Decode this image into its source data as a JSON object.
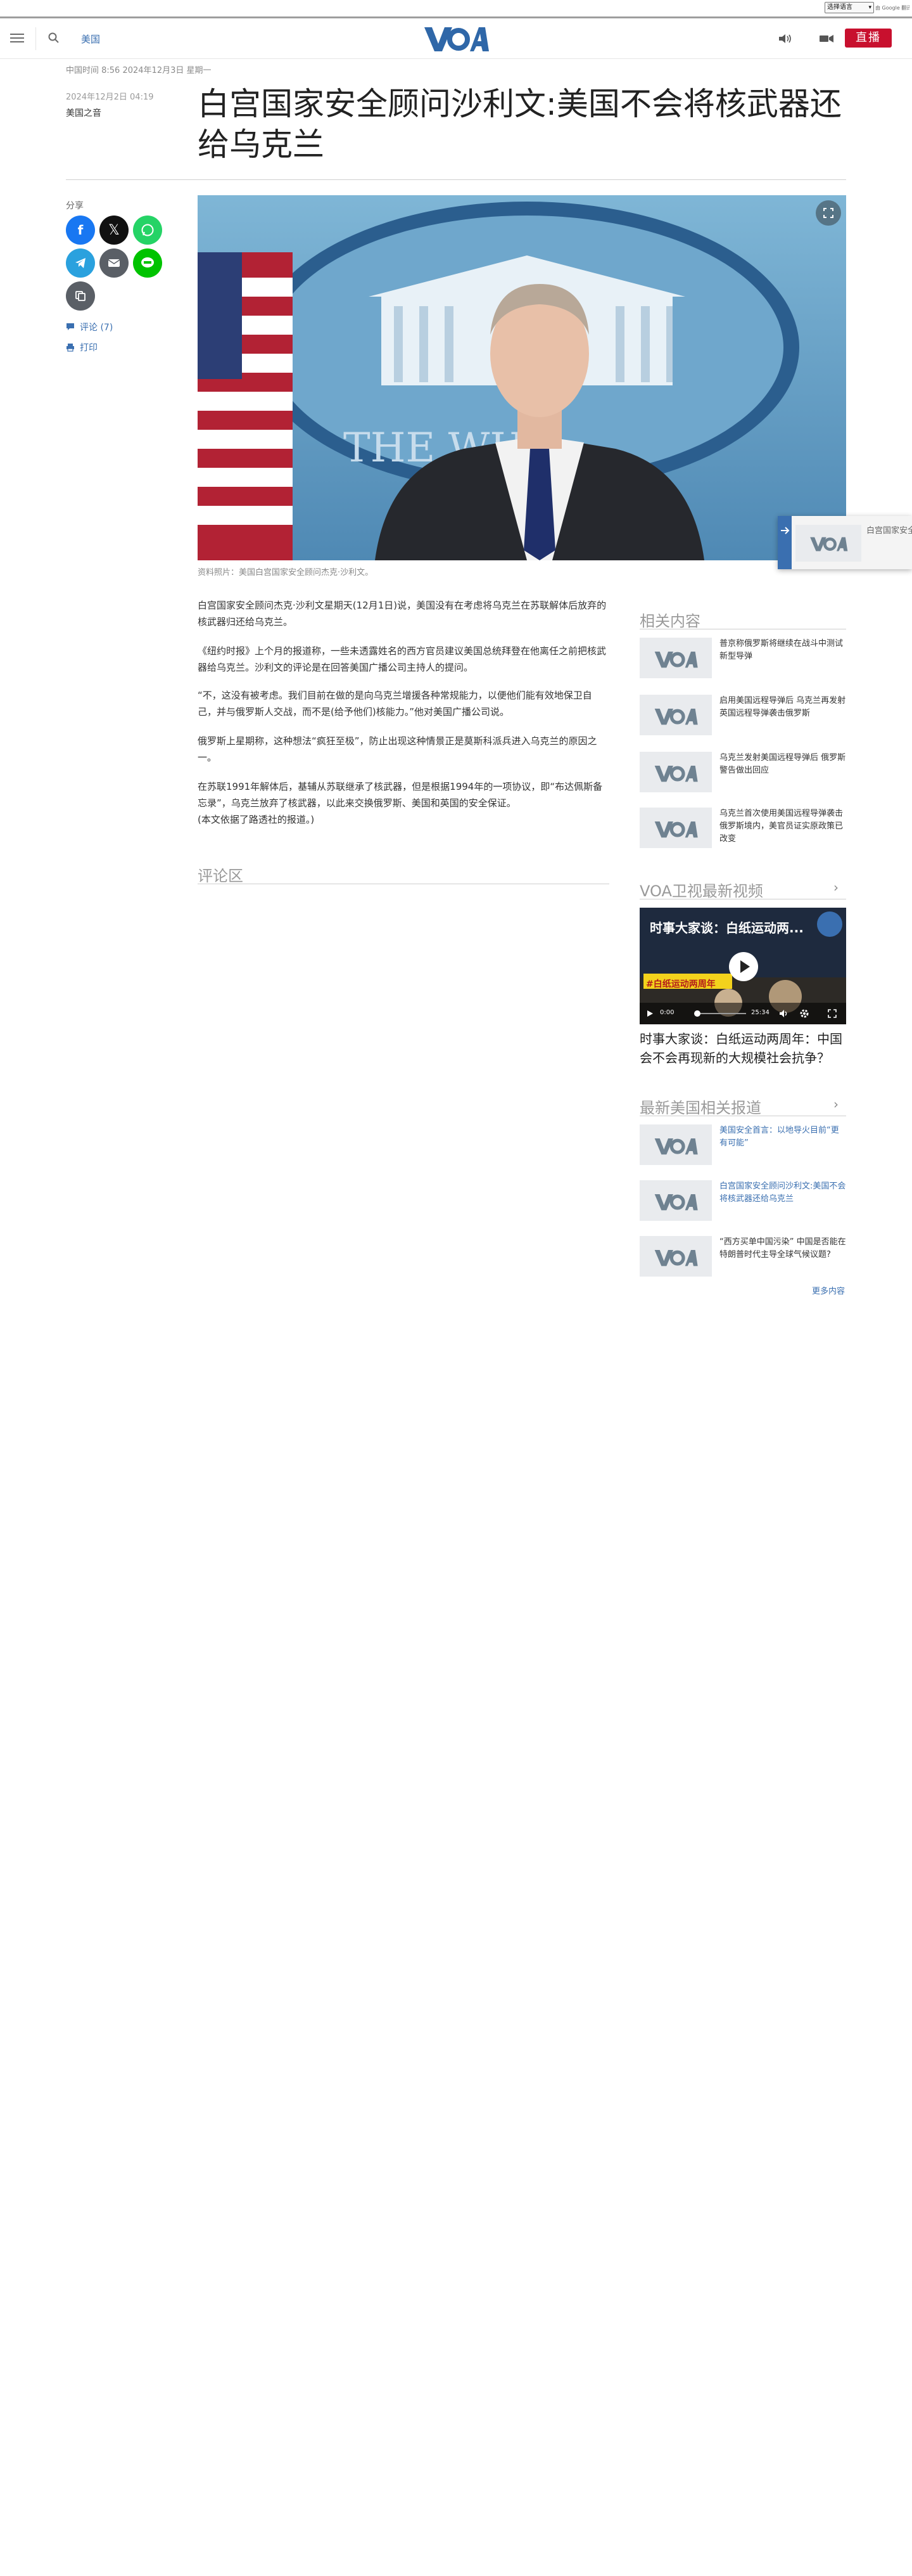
{
  "translate": {
    "select_label": "选择语言",
    "powered_by": "由 Google 翻译提供支持"
  },
  "header": {
    "section": "美国",
    "live_label": "直播"
  },
  "article": {
    "dateline": "中国时间 8:56 2024年12月3日 星期一",
    "pubdate": "2024年12月2日 04:19",
    "author": "美国之音",
    "title": "白宫国家安全顾问沙利文:美国不会将核武器还给乌克兰",
    "hero_caption": "资料照片：美国白宫国家安全顾问杰克·沙利文。",
    "hero_seal_text": "THE WH",
    "paragraphs": [
      "白宫国家安全顾问杰克·沙利文星期天(12月1日)说，美国没有在考虑将乌克兰在苏联解体后放弃的核武器归还给乌克兰。",
      "《纽约时报》上个月的报道称，一些未透露姓名的西方官员建议美国总统拜登在他离任之前把核武器给乌克兰。沙利文的评论是在回答美国广播公司主持人的提问。",
      "“不，这没有被考虑。我们目前在做的是向乌克兰增援各种常规能力，以便他们能有效地保卫自己，并与俄罗斯人交战，而不是(给予他们)核能力。”他对美国广播公司说。",
      "俄罗斯上星期称，这种想法“疯狂至极”，防止出现这种情景正是莫斯科派兵进入乌克兰的原因之一。",
      "在苏联1991年解体后，基辅从苏联继承了核武器，但是根据1994年的一项协议，即“布达佩斯备忘录”，乌克兰放弃了核武器，以此来交换俄罗斯、美国和英国的安全保证。\n(本文依据了路透社的报道。)"
    ],
    "comments_heading": "评论区"
  },
  "share": {
    "label": "分享",
    "comments_link": "评论 (7)",
    "print_link": "打印"
  },
  "floating_card": {
    "text": "白宫国家安全顾问沙利文:美国不会将核武"
  },
  "rail": {
    "related": {
      "title": "相关内容",
      "items": [
        "普京称俄罗斯将继续在战斗中测试新型导弹",
        "启用美国远程导弹后 乌克兰再发射英国远程导弹袭击俄罗斯",
        "乌克兰发射美国远程导弹后 俄罗斯警告做出回应",
        "乌克兰首次使用美国远程导弹袭击俄罗斯境内，美官员证实原政策已改变"
      ]
    },
    "tv": {
      "title": "VOA卫视最新视频",
      "video_overlay_title": "时事大家谈：白纸运动两...",
      "video_banner": "#白纸运动两周年",
      "time_current": "0:00",
      "time_total": "25:34",
      "video_title": "时事大家谈：白纸运动两周年：中国会不会再现新的大规模社会抗争？"
    },
    "latest": {
      "title": "最新美国相关报道",
      "items": [
        "美国安全首言：以地导火目前“更有可能”",
        "白宫国家安全顾问沙利文:美国不会将核武器还给乌克兰",
        "“西方买单中国污染” 中国是否能在特朗普时代主导全球气候议题?"
      ],
      "more": "更多内容"
    }
  },
  "colors": {
    "brand_blue": "#3a6fb0",
    "live_red": "#c8102e",
    "facebook": "#1877f2",
    "x": "#111111",
    "whatsapp": "#25d366",
    "telegram": "#2aa1de",
    "email": "#5a5f66",
    "line": "#00c300",
    "copy": "#5a5f66"
  },
  "icons": [
    "menu-icon",
    "search-icon",
    "voa-logo",
    "audio-icon",
    "video-icon",
    "facebook-icon",
    "x-icon",
    "whatsapp-icon",
    "telegram-icon",
    "email-icon",
    "line-icon",
    "copy-link-icon",
    "comment-icon",
    "print-icon",
    "fullscreen-icon",
    "chevron-right-icon",
    "play-icon",
    "volume-icon",
    "settings-icon",
    "share-icon"
  ]
}
